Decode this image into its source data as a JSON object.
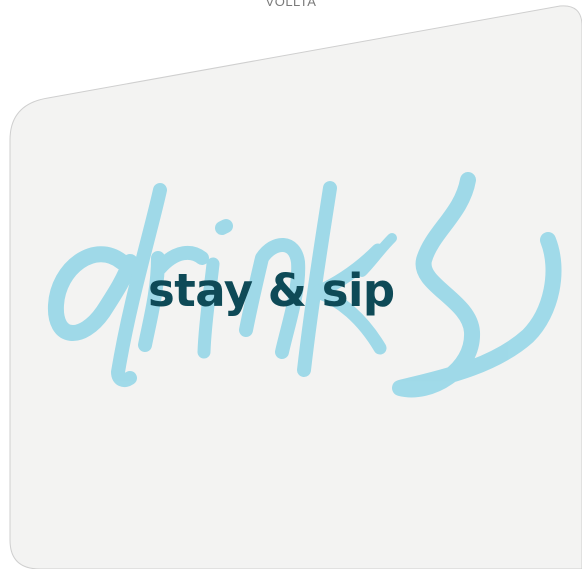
{
  "brand": {
    "name": "VOLLTA"
  },
  "card": {
    "background_color": "#f3f3f2",
    "border_color": "#cfcfcf"
  },
  "script_word": {
    "text": "drinks",
    "color": "#9bd8e8"
  },
  "headline": {
    "text": "stay & sip",
    "color": "#0e4a57"
  }
}
